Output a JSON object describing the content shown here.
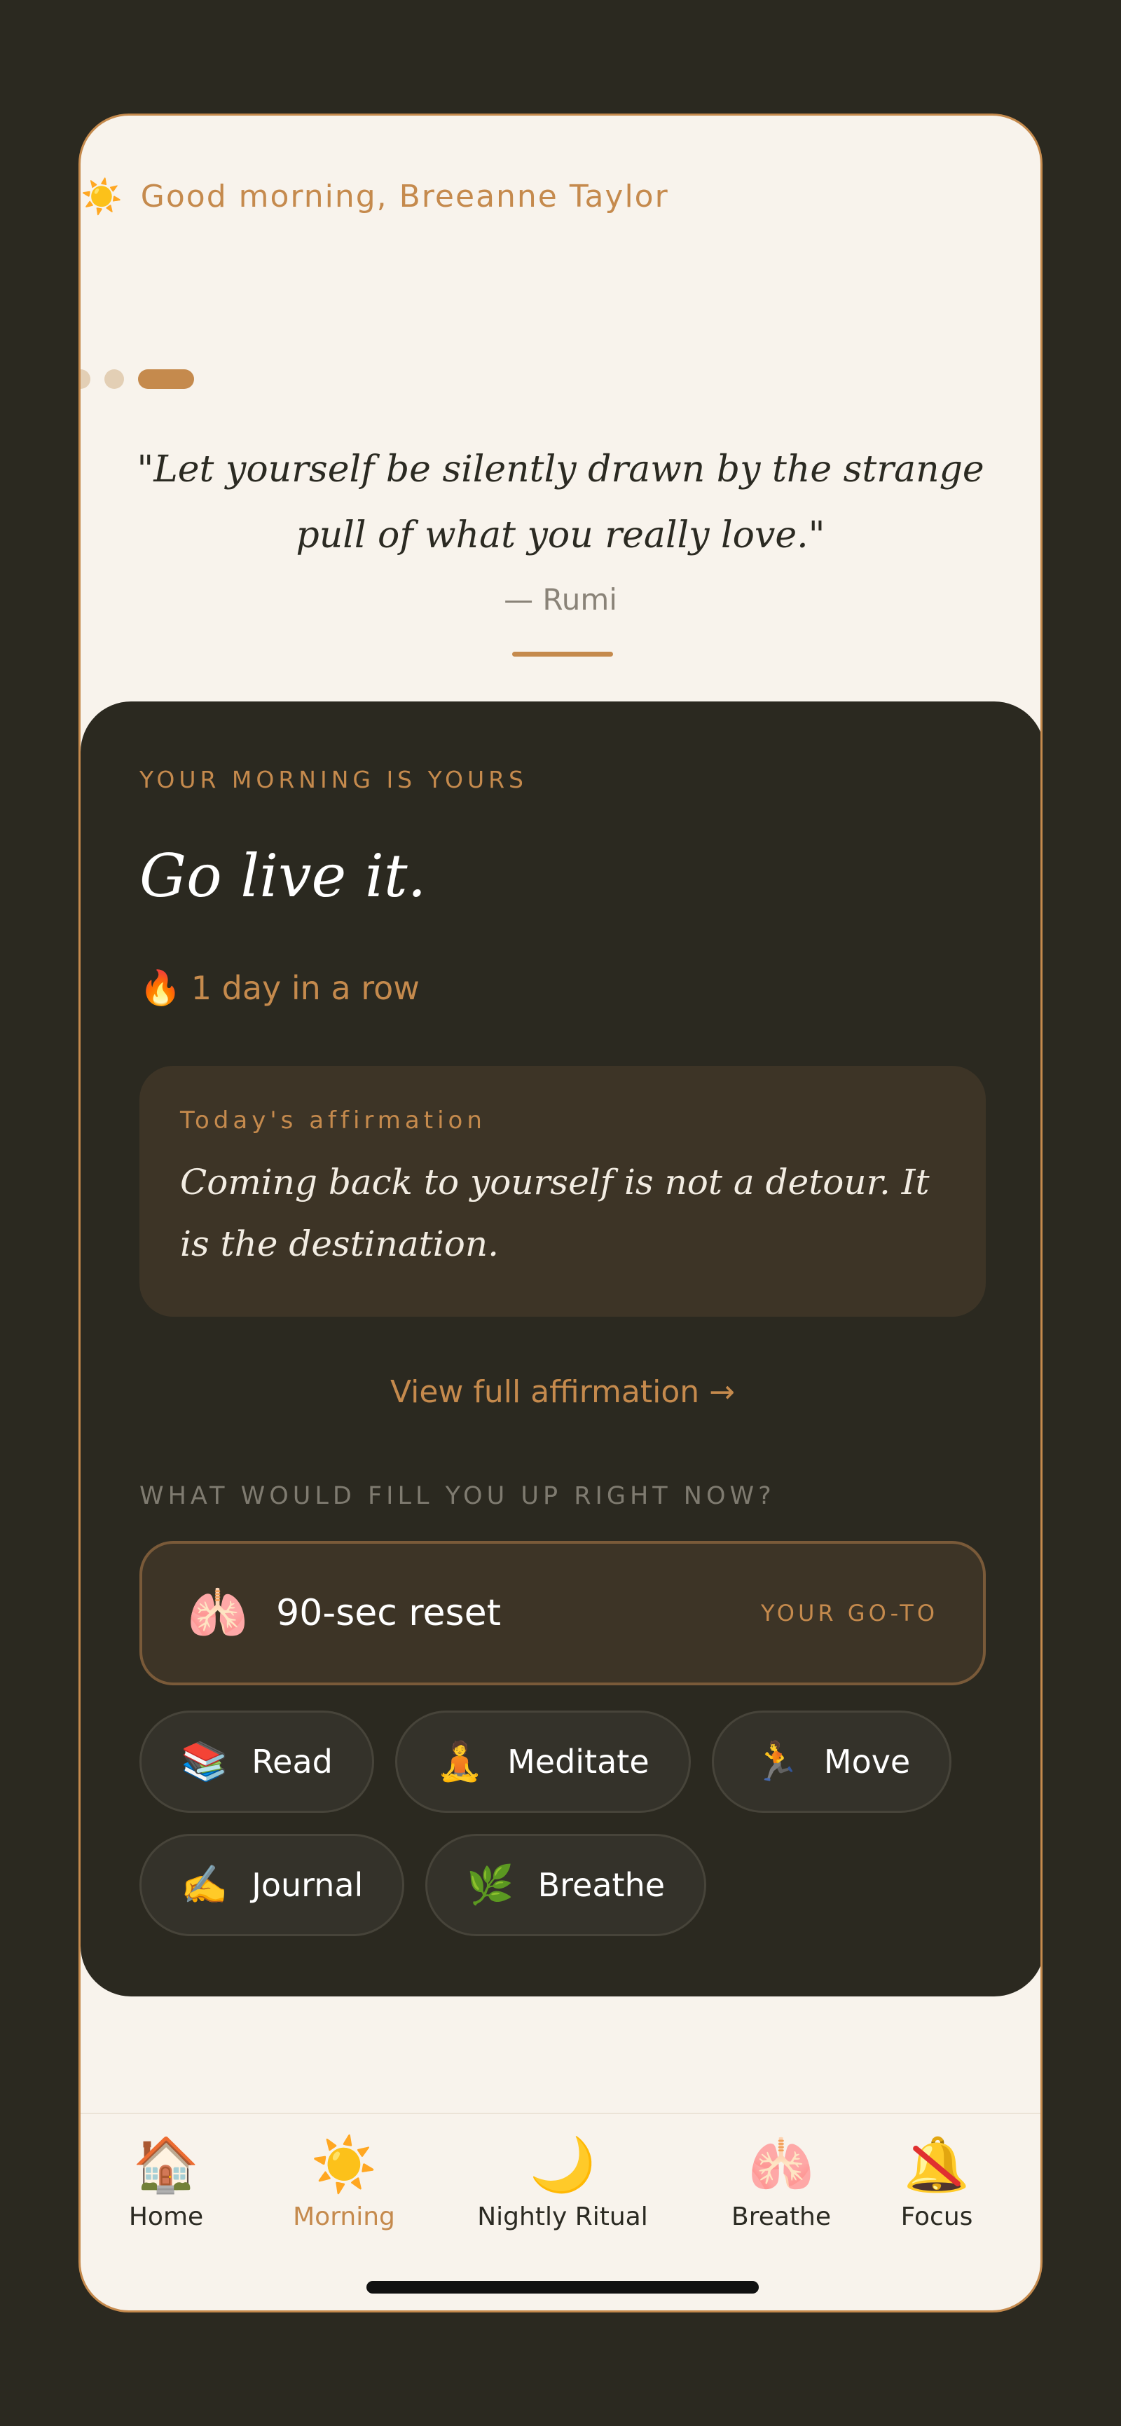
{
  "header": {
    "greeting_icon": "sun-icon",
    "greeting": "Good morning, Breeanne Taylor"
  },
  "carousel": {
    "total": 3,
    "active_index": 3
  },
  "quote": {
    "text": "\"Let yourself be silently drawn by the strange pull of what you really love.\"",
    "author": "— Rumi"
  },
  "card": {
    "eyebrow": "YOUR MORNING IS YOURS",
    "headline": "Go live it.",
    "streak_icon": "🔥",
    "streak": "1 day in a row",
    "affirmation_label": "Today's affirmation",
    "affirmation": "Coming back to yourself is not a detour. It is the destination.",
    "view_link": "View full affirmation →",
    "section_label": "WHAT WOULD FILL YOU UP RIGHT NOW?",
    "goto": {
      "icon": "🫁",
      "label": "90-sec reset",
      "badge": "YOUR GO-TO"
    },
    "options": [
      {
        "icon": "📚",
        "label": "Read"
      },
      {
        "icon": "🧘",
        "label": "Meditate"
      },
      {
        "icon": "🏃",
        "label": "Move"
      },
      {
        "icon": "✍️",
        "label": "Journal"
      },
      {
        "icon": "🌿",
        "label": "Breathe"
      }
    ]
  },
  "nav": [
    {
      "icon": "🏠",
      "label": "Home"
    },
    {
      "icon": "☀️",
      "label": "Morning",
      "active": true
    },
    {
      "icon": "🌙",
      "label": "Nightly Ritual"
    },
    {
      "icon": "🫁",
      "label": "Breathe"
    },
    {
      "icon": "🔔",
      "label": "Focus"
    }
  ],
  "colors": {
    "accent": "#c58a4d",
    "dark": "#2b2920",
    "cream": "#f8f3ec",
    "card_inner": "#3d3426"
  }
}
